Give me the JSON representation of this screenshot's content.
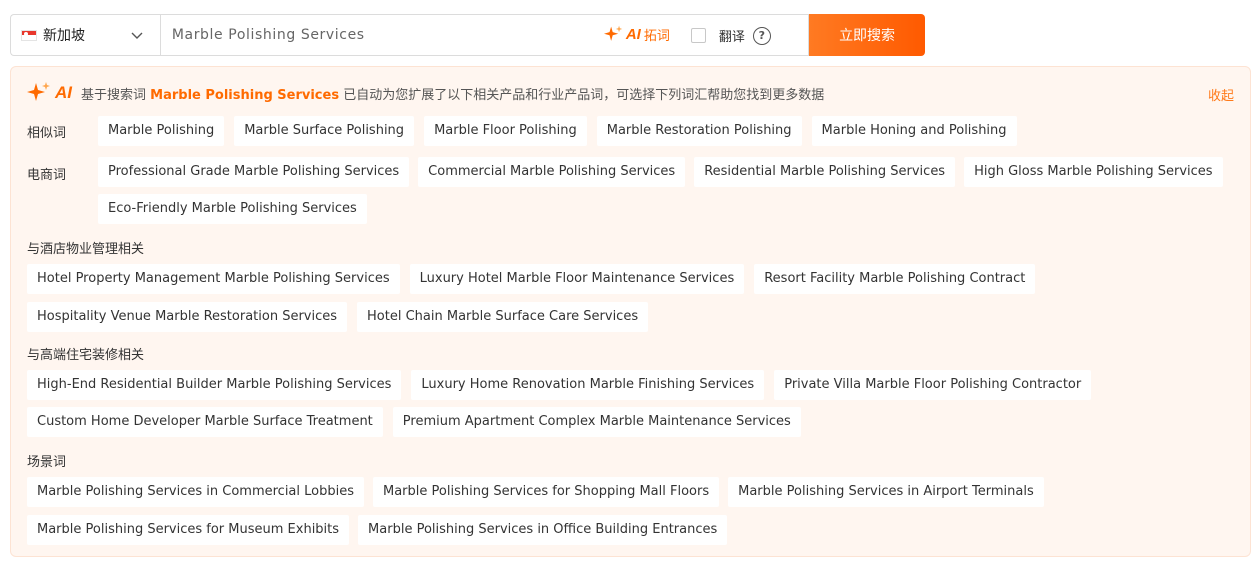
{
  "search": {
    "country": "新加坡",
    "query": "Marble Polishing Services",
    "ai_badge": "AI",
    "ai_expand_label": "拓词",
    "translate_label": "翻译",
    "help_symbol": "?",
    "search_button": "立即搜索"
  },
  "panel": {
    "ai_badge": "AI",
    "intro_prefix": "基于搜索词",
    "intro_keyword": "Marble Polishing Services",
    "intro_suffix": "已自动为您扩展了以下相关产品和行业产品词，可选择下列词汇帮助您找到更多数据",
    "collapse": "收起",
    "groups": {
      "similar": {
        "label": "相似词",
        "tags": [
          "Marble Polishing",
          "Marble Surface Polishing",
          "Marble Floor Polishing",
          "Marble Restoration Polishing",
          "Marble Honing and Polishing"
        ]
      },
      "ecommerce": {
        "label": "电商词",
        "tags": [
          "Professional Grade Marble Polishing Services",
          "Commercial Marble Polishing Services",
          "Residential Marble Polishing Services",
          "High Gloss Marble Polishing Services",
          "Eco-Friendly Marble Polishing Services"
        ]
      },
      "hotel": {
        "label": "与酒店物业管理相关",
        "tags": [
          "Hotel Property Management Marble Polishing Services",
          "Luxury Hotel Marble Floor Maintenance Services",
          "Resort Facility Marble Polishing Contract",
          "Hospitality Venue Marble Restoration Services",
          "Hotel Chain Marble Surface Care Services"
        ]
      },
      "residential": {
        "label": "与高端住宅装修相关",
        "tags": [
          "High-End Residential Builder Marble Polishing Services",
          "Luxury Home Renovation Marble Finishing Services",
          "Private Villa Marble Floor Polishing Contractor",
          "Custom Home Developer Marble Surface Treatment",
          "Premium Apartment Complex Marble Maintenance Services"
        ]
      },
      "scene": {
        "label": "场景词",
        "tags": [
          "Marble Polishing Services in Commercial Lobbies",
          "Marble Polishing Services for Shopping Mall Floors",
          "Marble Polishing Services in Airport Terminals",
          "Marble Polishing Services for Museum Exhibits",
          "Marble Polishing Services in Office Building Entrances"
        ]
      }
    }
  },
  "colors": {
    "accent": "#ff6a00",
    "button": "#ff5a00",
    "panel_bg": "#fff6f0"
  },
  "icons": {
    "flag": "singapore-flag-icon",
    "chevron": "chevron-down-icon",
    "sparkle": "ai-sparkle-icon",
    "help": "help-circle-icon"
  }
}
